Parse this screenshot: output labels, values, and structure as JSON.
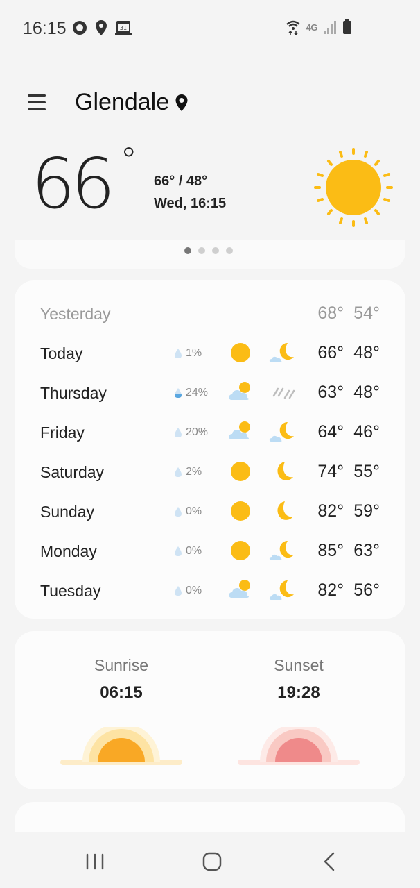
{
  "status_bar": {
    "time": "16:15",
    "network": "4G"
  },
  "header": {
    "city": "Glendale"
  },
  "current": {
    "temperature": "66",
    "degree_symbol": "°",
    "hi_lo": "66° / 48°",
    "datetime": "Wed, 16:15",
    "condition_icon": "sunny-icon"
  },
  "pager": {
    "pages": 4,
    "active": 0
  },
  "forecast": {
    "yesterday": {
      "label": "Yesterday",
      "high": "68°",
      "low": "54°"
    },
    "days": [
      {
        "day": "Today",
        "precip": "1%",
        "day_icon": "sunny-icon",
        "night_icon": "cloudy-moon-icon",
        "high": "66°",
        "low": "48°"
      },
      {
        "day": "Thursday",
        "precip": "24%",
        "day_icon": "partly-cloudy-icon",
        "night_icon": "rain-icon",
        "high": "63°",
        "low": "48°"
      },
      {
        "day": "Friday",
        "precip": "20%",
        "day_icon": "partly-cloudy-icon",
        "night_icon": "cloudy-moon-icon",
        "high": "64°",
        "low": "46°"
      },
      {
        "day": "Saturday",
        "precip": "2%",
        "day_icon": "sunny-icon",
        "night_icon": "moon-icon",
        "high": "74°",
        "low": "55°"
      },
      {
        "day": "Sunday",
        "precip": "0%",
        "day_icon": "sunny-icon",
        "night_icon": "moon-icon",
        "high": "82°",
        "low": "59°"
      },
      {
        "day": "Monday",
        "precip": "0%",
        "day_icon": "sunny-icon",
        "night_icon": "cloudy-moon-icon",
        "high": "85°",
        "low": "63°"
      },
      {
        "day": "Tuesday",
        "precip": "0%",
        "day_icon": "partly-cloudy-icon",
        "night_icon": "cloudy-moon-icon",
        "high": "82°",
        "low": "56°"
      }
    ]
  },
  "sun": {
    "sunrise_label": "Sunrise",
    "sunrise_time": "06:15",
    "sunset_label": "Sunset",
    "sunset_time": "19:28"
  },
  "colors": {
    "sun": "#fbbc15",
    "cloud": "#bcdcf4",
    "sunrise": "#f9a825",
    "sunset": "#ef8a8a"
  }
}
